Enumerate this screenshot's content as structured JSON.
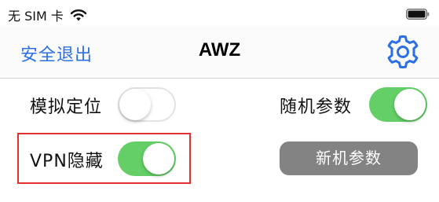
{
  "status_bar": {
    "carrier": "无 SIM 卡",
    "wifi_icon": "wifi-icon",
    "battery_icon": "battery-icon"
  },
  "nav": {
    "logout_label": "安全退出",
    "title": "AWZ",
    "settings_icon": "gear-icon",
    "accent_color": "#2b6fe6"
  },
  "rows": {
    "mock_location": {
      "label": "模拟定位",
      "enabled": false
    },
    "random_params": {
      "label": "随机参数",
      "enabled": true
    },
    "vpn_hide": {
      "label": "VPN隐藏",
      "enabled": true
    },
    "new_params_button": "新机参数"
  },
  "colors": {
    "toggle_on": "#63cf66",
    "highlight": "#e0312e",
    "button_gray": "#838383"
  }
}
